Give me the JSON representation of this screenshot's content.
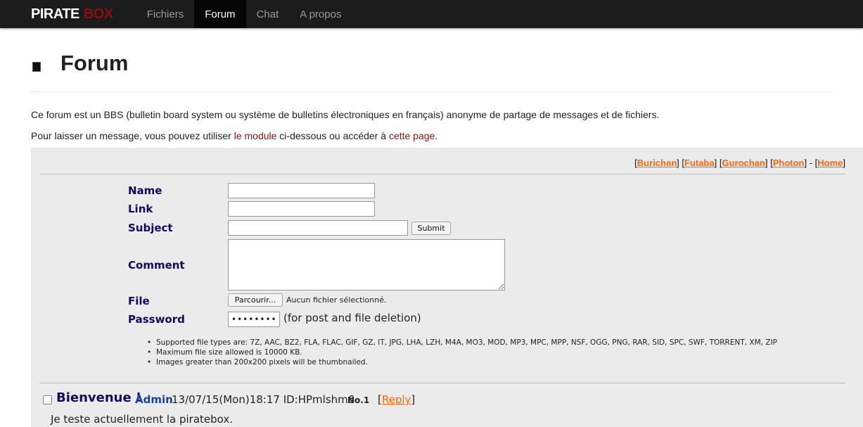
{
  "nav": {
    "brand_part1": "PIRATE",
    "brand_part2": "BOX",
    "items": [
      {
        "label": "Fichiers"
      },
      {
        "label": "Forum"
      },
      {
        "label": "Chat"
      },
      {
        "label": "A propos"
      }
    ],
    "active": "Forum"
  },
  "page": {
    "title": "Forum",
    "intro1": "Ce forum est un BBS (bulletin board system ou système de bulletins électroniques en français) anonyme de partage de messages et de fichiers.",
    "intro2_prefix": "Pour laisser un message, vous pouvez utiliser ",
    "intro2_link1": "le module",
    "intro2_middle": " ci-dessous ou accéder à ",
    "intro2_link2": "cette page",
    "intro2_suffix": "."
  },
  "board": {
    "links": [
      "Burichan",
      "Futaba",
      "Gurochan",
      "Photon",
      "Home"
    ],
    "form": {
      "name_label": "Name",
      "link_label": "Link",
      "subject_label": "Subject",
      "submit_label": "Submit",
      "comment_label": "Comment",
      "file_label": "File",
      "browse_label": "Parcourir...",
      "no_file_text": "Aucun fichier sélectionné.",
      "password_label": "Password",
      "password_value": "••••••••",
      "password_note": "(for post and file deletion)"
    },
    "rules": [
      "Supported file types are: 7Z, AAC, BZ2, FLA, FLAC, GIF, GZ, IT, JPG, LHA, LZH, M4A, MO3, MOD, MP3, MPC, MPP, NSF, OGG, PNG, RAR, SID, SPC, SWF, TORRENT, XM, ZIP",
      "Maximum file size allowed is 10000 KB.",
      "Images greater than 200x200 pixels will be thumbnailed."
    ],
    "post": {
      "subject": "Bienvenue !",
      "author": "Admin",
      "date": "13/07/15(Mon)18:17 ID:HPmlshm6",
      "number": "No.1",
      "reply_label": "Reply",
      "body": "Je teste actuellement la piratebox."
    }
  },
  "colors": {
    "accent_link": "#ff6600",
    "label_navy": "#0f0c5d",
    "brand_red": "#8a1111"
  }
}
